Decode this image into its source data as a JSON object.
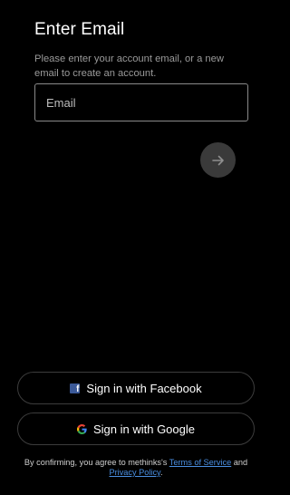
{
  "header": {
    "title": "Enter Email",
    "subtitle": "Please enter your account email, or a new email to create an account."
  },
  "email": {
    "placeholder": "Email",
    "value": ""
  },
  "next_button": {
    "icon": "arrow-right-icon"
  },
  "social": {
    "facebook_label": "Sign in with Facebook",
    "facebook_icon": "facebook-icon",
    "google_label": "Sign in with Google",
    "google_icon": "google-icon"
  },
  "footer": {
    "prefix": "By confirming, you agree to methinks's",
    "terms_link": "Terms of Service",
    "and": "and",
    "privacy_link": "Privacy Policy",
    "suffix": "."
  },
  "colors": {
    "background": "#000000",
    "link": "#4a8fe2",
    "facebook": "#3b5998",
    "next_button_bg": "#3a3a3a"
  }
}
